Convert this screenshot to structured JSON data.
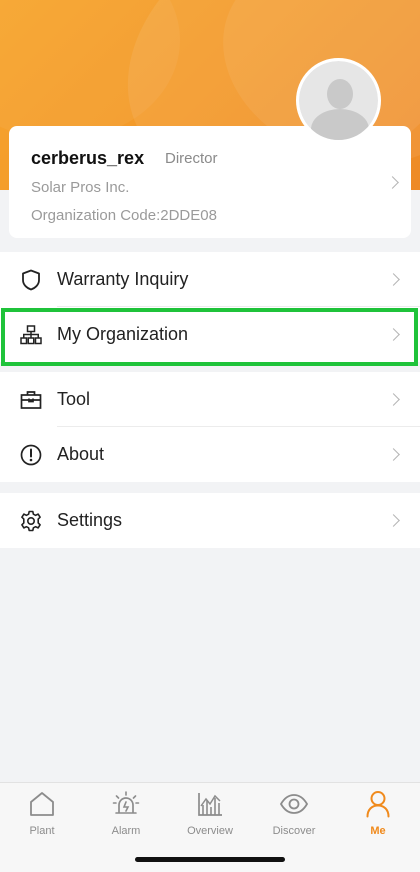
{
  "profile": {
    "username": "cerberus_rex",
    "role": "Director",
    "company": "Solar Pros Inc.",
    "org_code": "Organization Code:2DDE08"
  },
  "menu": {
    "warranty": "Warranty Inquiry",
    "organization": "My Organization",
    "tool": "Tool",
    "about": "About",
    "settings": "Settings"
  },
  "tabs": {
    "plant": "Plant",
    "alarm": "Alarm",
    "overview": "Overview",
    "discover": "Discover",
    "me": "Me"
  },
  "colors": {
    "accent": "#f08a1c",
    "highlight": "#1fc33a",
    "header_gradient": [
      "#f7a52d",
      "#ee8a26"
    ]
  },
  "icons": {
    "warranty": "shield-icon",
    "organization": "org-chart-icon",
    "tool": "toolbox-icon",
    "about": "info-circle-icon",
    "settings": "gear-icon",
    "plant": "house-icon",
    "alarm": "alarm-siren-icon",
    "overview": "chart-icon",
    "discover": "eye-icon",
    "me": "person-icon"
  }
}
